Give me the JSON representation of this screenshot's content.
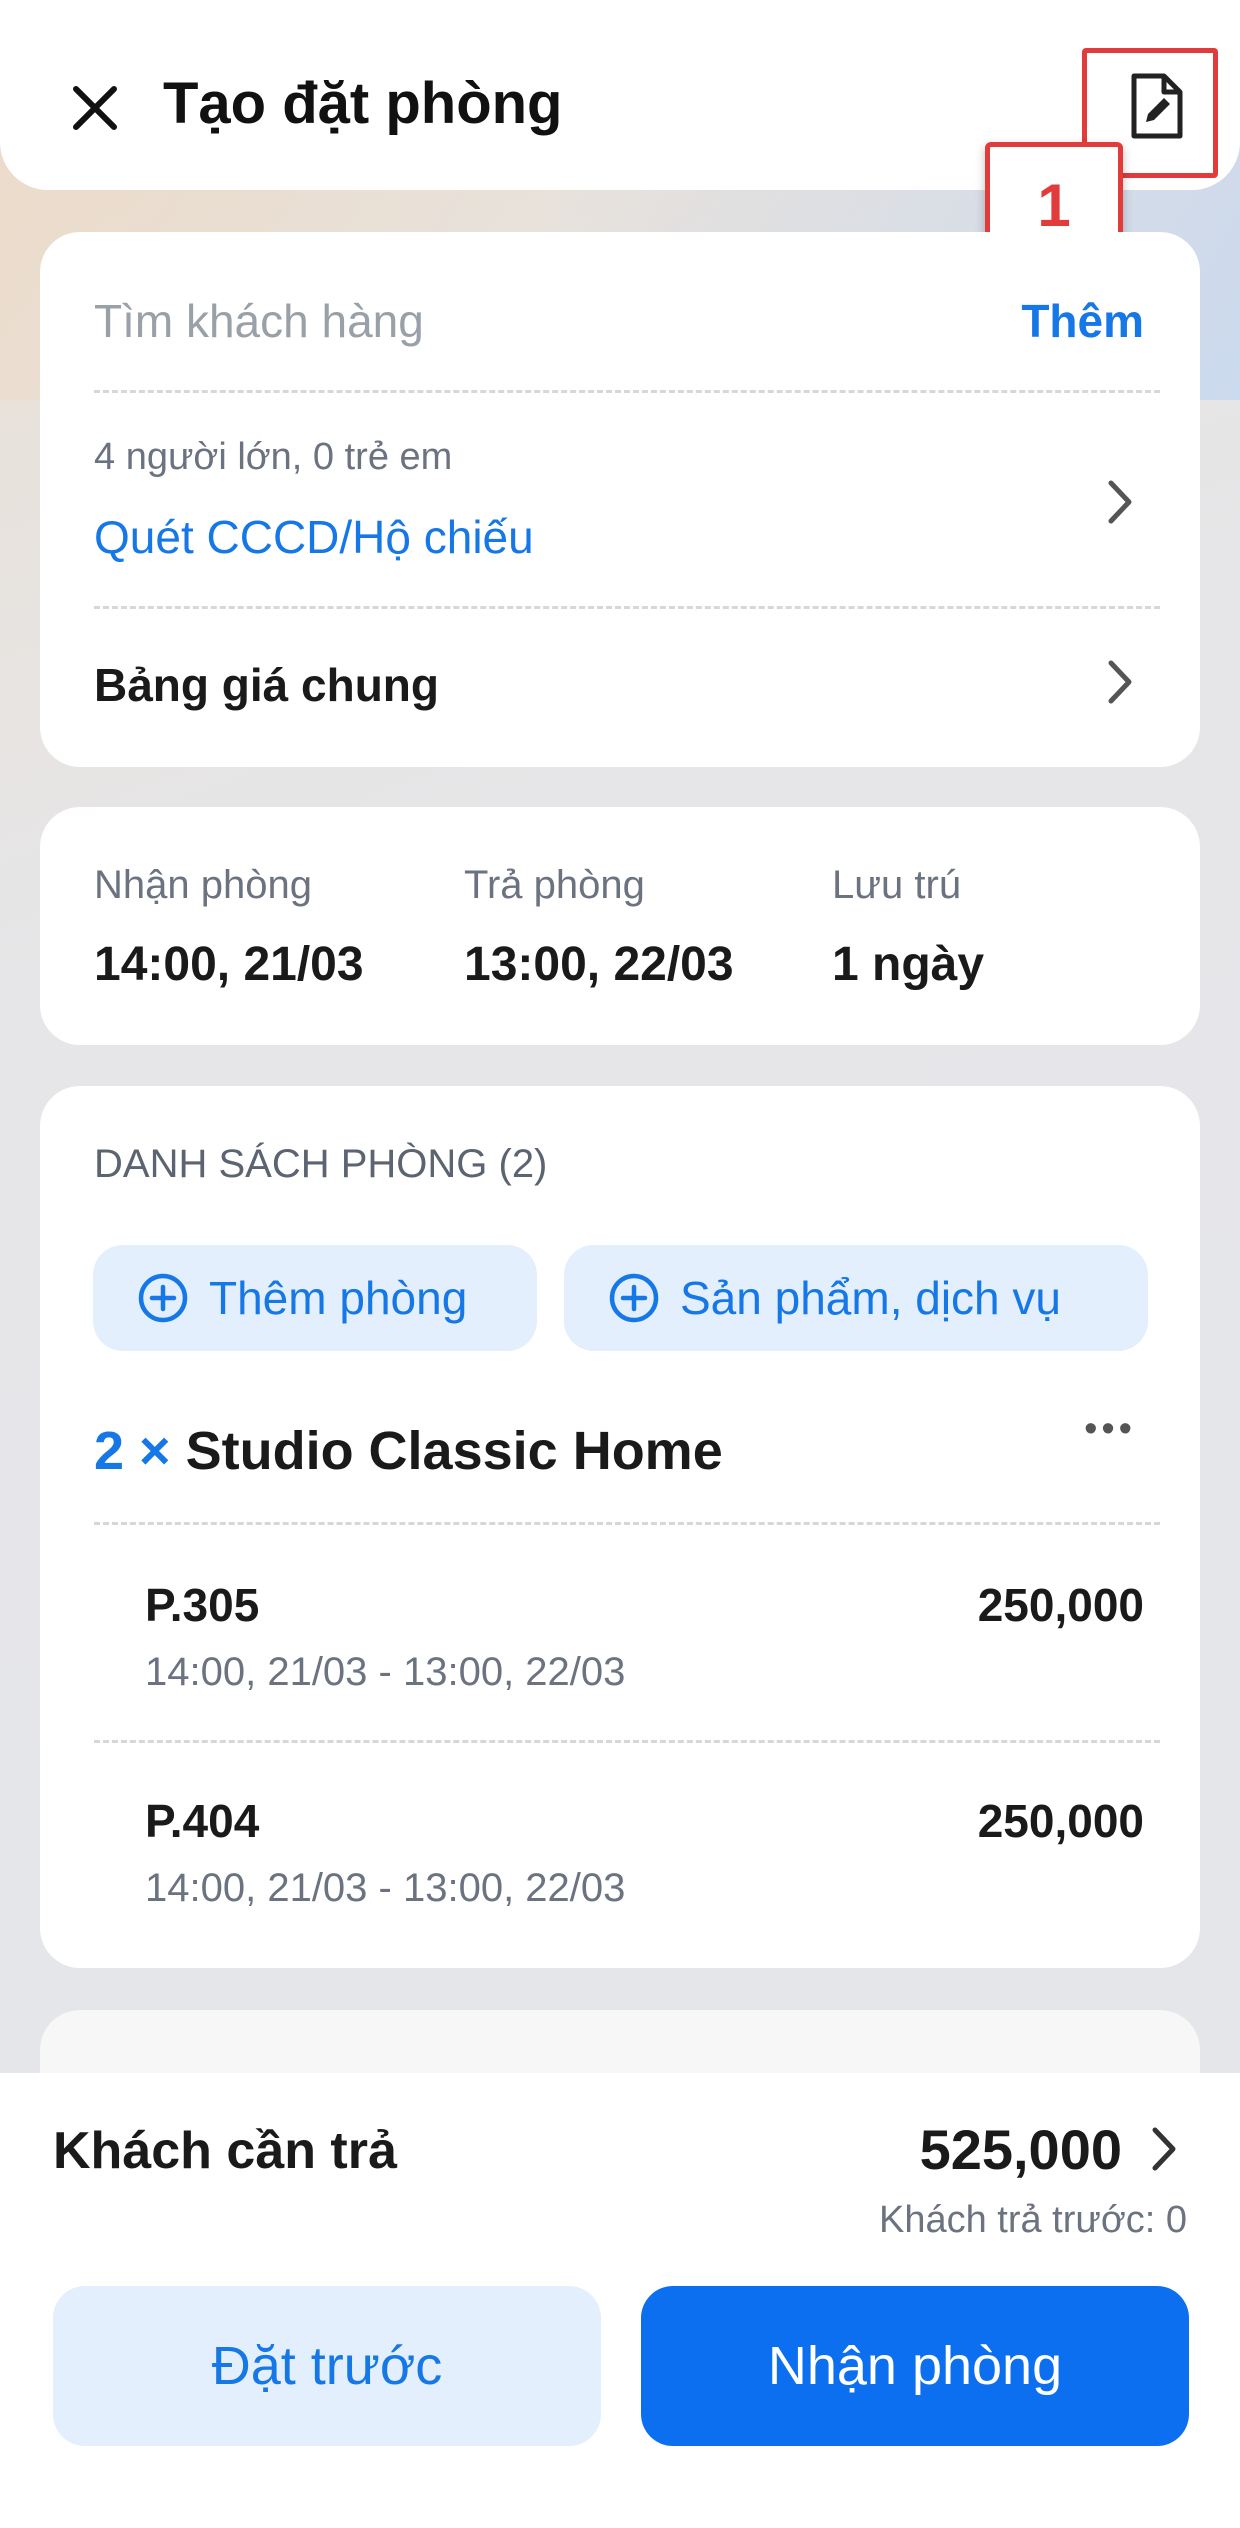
{
  "header": {
    "title": "Tạo đặt phòng",
    "step_badge": "1"
  },
  "customer": {
    "search_placeholder": "Tìm khách hàng",
    "add_label": "Thêm",
    "guests_summary": "4 người lớn, 0 trẻ em",
    "scan_label": "Quét CCCD/Hộ chiếu",
    "price_list_label": "Bảng giá chung"
  },
  "stay": {
    "checkin_label": "Nhận phòng",
    "checkin_value": "14:00, 21/03",
    "checkout_label": "Trả phòng",
    "checkout_value": "13:00, 22/03",
    "duration_label": "Lưu trú",
    "duration_value": "1 ngày"
  },
  "rooms": {
    "section_title": "DANH SÁCH PHÒNG (2)",
    "add_room_label": "Thêm phòng",
    "add_service_label": "Sản phẩm, dịch vụ",
    "group_quantity": "2 ×",
    "group_name": "Studio Classic Home",
    "more_label": "•••",
    "items": [
      {
        "name": "P.305",
        "price": "250,000",
        "period": "14:00, 21/03 - 13:00, 22/03"
      },
      {
        "name": "P.404",
        "price": "250,000",
        "period": "14:00, 21/03 - 13:00, 22/03"
      }
    ]
  },
  "summary": {
    "total_label": "Khách cần trả",
    "total_value": "525,000",
    "prepaid_text": "Khách trả trước: 0"
  },
  "actions": {
    "reserve_label": "Đặt trước",
    "checkin_label": "Nhận phòng"
  },
  "colors": {
    "accent": "#1677e6",
    "primary_button": "#0b6ff0",
    "annotation": "#e23b3b"
  }
}
